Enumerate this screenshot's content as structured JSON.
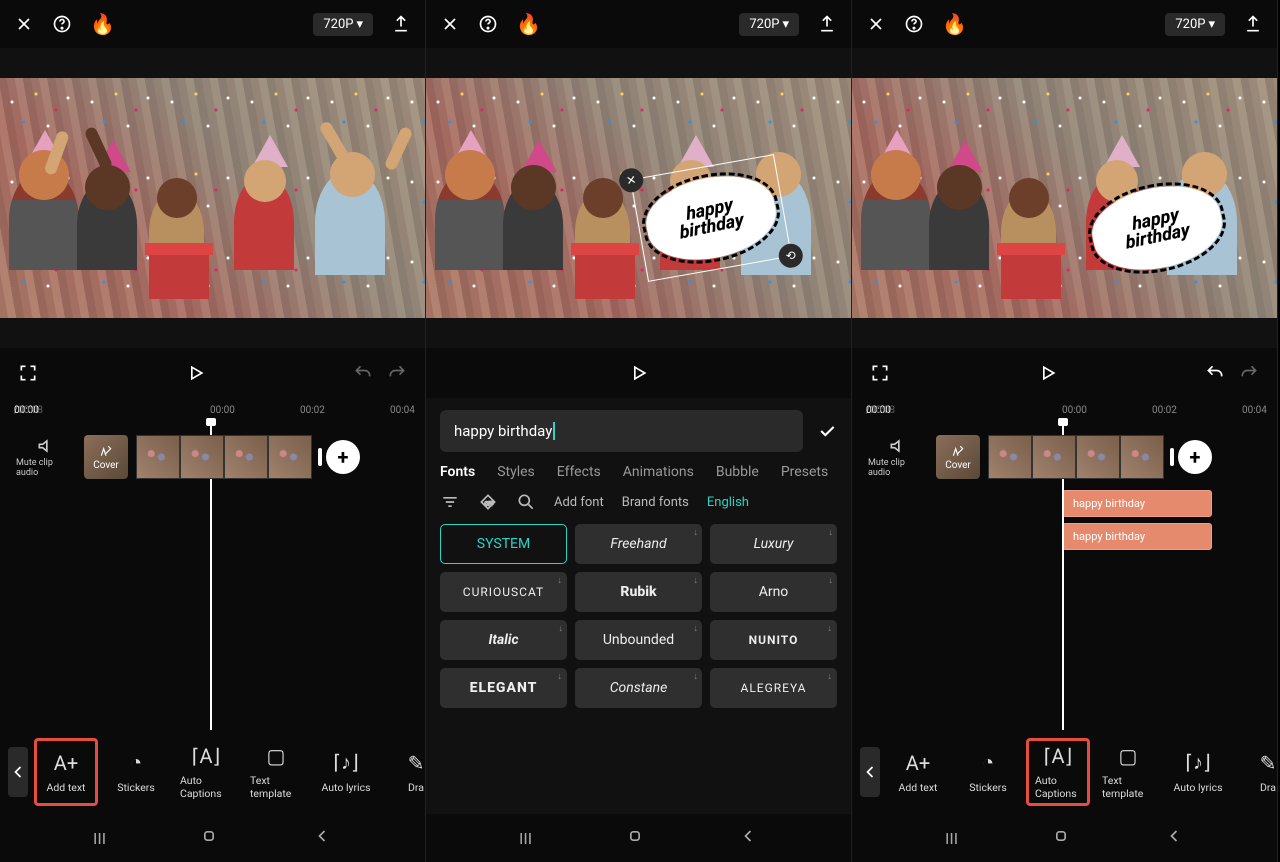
{
  "topbar": {
    "resolution": "720P"
  },
  "overlay": {
    "line1": "happy",
    "line2": "birthday"
  },
  "playhead": {
    "current": "00:00",
    "duration": "00:08"
  },
  "ruler": {
    "t0": "00:00",
    "t1": "00:02",
    "t2": "00:04"
  },
  "mute_label": "Mute clip audio",
  "cover_label": "Cover",
  "text_clips": {
    "a": "happy birthday",
    "b": "happy birthday"
  },
  "tools": {
    "add_text": "Add text",
    "stickers": "Stickers",
    "auto_captions": "Auto Captions",
    "text_template": "Text template",
    "auto_lyrics": "Auto lyrics",
    "draw": "Dra"
  },
  "editor": {
    "input_value": "happy birthday",
    "tabs": {
      "fonts": "Fonts",
      "styles": "Styles",
      "effects": "Effects",
      "animations": "Animations",
      "bubble": "Bubble",
      "presets": "Presets"
    },
    "filter": {
      "add_font": "Add font",
      "brand_fonts": "Brand fonts",
      "language": "English"
    },
    "fonts": {
      "system": "SYSTEM",
      "freehand": "Freehand",
      "luxury": "Luxury",
      "curiouscat": "CURIOUSCAT",
      "rubik": "Rubik",
      "arno": "Arno",
      "italic": "Italic",
      "unbounded": "Unbounded",
      "nunito": "NUNITO",
      "elegant": "ELEGANT",
      "constane": "Constane",
      "alegreya": "ALEGREYA"
    }
  }
}
